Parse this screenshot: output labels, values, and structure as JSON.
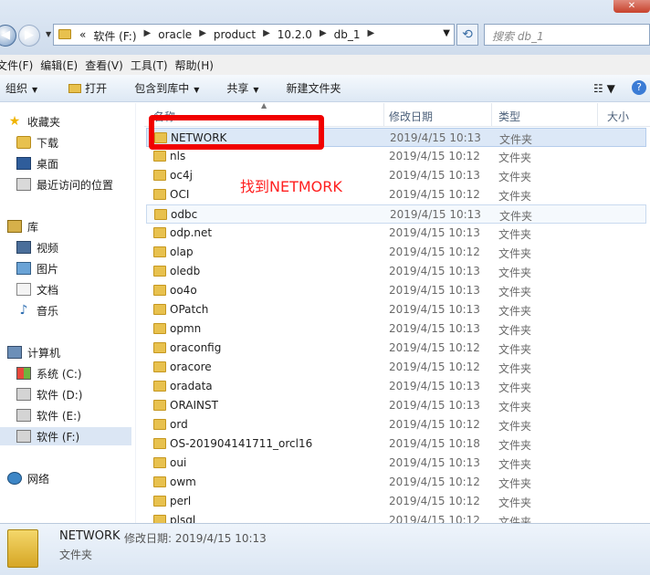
{
  "window": {
    "close_label": "✕"
  },
  "address": {
    "back_label": "◀",
    "forward_label": "▶",
    "prefix": "«",
    "crumbs": [
      "软件 (F:)",
      "oracle",
      "product",
      "10.2.0",
      "db_1"
    ],
    "crumb_sep": "▶",
    "search_placeholder": "搜索 db_1"
  },
  "menu": [
    "文件(F)",
    "编辑(E)",
    "查看(V)",
    "工具(T)",
    "帮助(H)"
  ],
  "toolbar": {
    "organize": "组织",
    "open": "打开",
    "include_library": "包含到库中",
    "share": "共享",
    "new_folder": "新建文件夹"
  },
  "nav": {
    "favorites": "收藏夹",
    "downloads": "下载",
    "desktop": "桌面",
    "recent": "最近访问的位置",
    "libraries": "库",
    "videos": "视频",
    "pictures": "图片",
    "documents": "文档",
    "music": "音乐",
    "computer": "计算机",
    "drive_c": "系统 (C:)",
    "drive_d": "软件 (D:)",
    "drive_e": "软件 (E:)",
    "drive_f": "软件 (F:)",
    "network": "网络"
  },
  "columns": {
    "name": "名称",
    "date": "修改日期",
    "type": "类型",
    "size": "大小"
  },
  "files": [
    {
      "name": "NETWORK",
      "date": "2019/4/15 10:13",
      "type": "文件夹"
    },
    {
      "name": "nls",
      "date": "2019/4/15 10:12",
      "type": "文件夹"
    },
    {
      "name": "oc4j",
      "date": "2019/4/15 10:13",
      "type": "文件夹"
    },
    {
      "name": "OCI",
      "date": "2019/4/15 10:12",
      "type": "文件夹"
    },
    {
      "name": "odbc",
      "date": "2019/4/15 10:13",
      "type": "文件夹"
    },
    {
      "name": "odp.net",
      "date": "2019/4/15 10:13",
      "type": "文件夹"
    },
    {
      "name": "olap",
      "date": "2019/4/15 10:12",
      "type": "文件夹"
    },
    {
      "name": "oledb",
      "date": "2019/4/15 10:13",
      "type": "文件夹"
    },
    {
      "name": "oo4o",
      "date": "2019/4/15 10:13",
      "type": "文件夹"
    },
    {
      "name": "OPatch",
      "date": "2019/4/15 10:13",
      "type": "文件夹"
    },
    {
      "name": "opmn",
      "date": "2019/4/15 10:13",
      "type": "文件夹"
    },
    {
      "name": "oraconfig",
      "date": "2019/4/15 10:12",
      "type": "文件夹"
    },
    {
      "name": "oracore",
      "date": "2019/4/15 10:12",
      "type": "文件夹"
    },
    {
      "name": "oradata",
      "date": "2019/4/15 10:13",
      "type": "文件夹"
    },
    {
      "name": "ORAINST",
      "date": "2019/4/15 10:13",
      "type": "文件夹"
    },
    {
      "name": "ord",
      "date": "2019/4/15 10:12",
      "type": "文件夹"
    },
    {
      "name": "OS-201904141711_orcl16",
      "date": "2019/4/15 10:18",
      "type": "文件夹"
    },
    {
      "name": "oui",
      "date": "2019/4/15 10:13",
      "type": "文件夹"
    },
    {
      "name": "owm",
      "date": "2019/4/15 10:12",
      "type": "文件夹"
    },
    {
      "name": "perl",
      "date": "2019/4/15 10:12",
      "type": "文件夹"
    },
    {
      "name": "plsql",
      "date": "2019/4/15 10:12",
      "type": "文件夹"
    }
  ],
  "annotation": "找到NETMORK",
  "details": {
    "name": "NETWORK",
    "meta": "修改日期: 2019/4/15 10:13",
    "type": "文件夹"
  }
}
